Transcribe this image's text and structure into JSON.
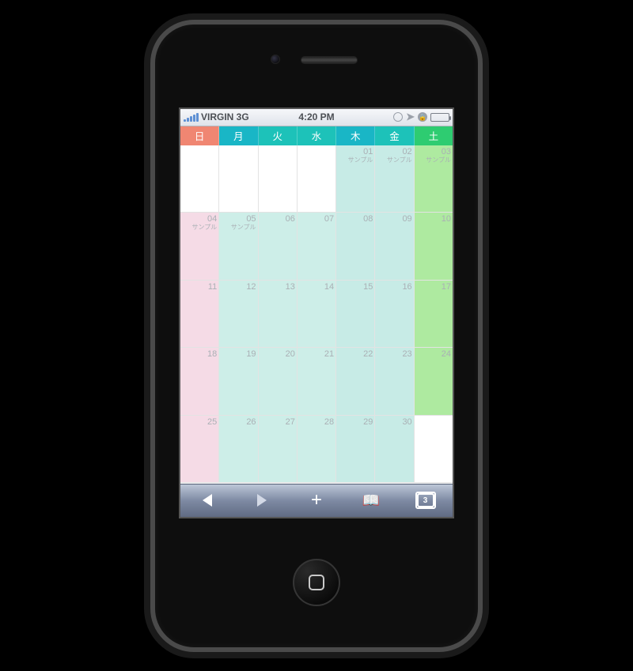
{
  "statusbar": {
    "carrier": "VIRGIN 3G",
    "time": "4:20 PM"
  },
  "safari": {
    "pages_count": "3"
  },
  "calendar": {
    "weekday_colors": {
      "sun": "#f08672",
      "mon": "#19b6c6",
      "tue": "#1dc2b9",
      "wed": "#1dc2b9",
      "thu": "#19b6c6",
      "fri": "#1dc2b9",
      "sat": "#2ecc71"
    },
    "cell_colors": {
      "blank": "#ffffff",
      "sun": "#f5dbe6",
      "weekday": "#cdeee8",
      "thu": "#c7ebe6",
      "fri": "#c7ebe6",
      "sat": "#aeeaa0"
    },
    "weekdays": [
      "日",
      "月",
      "火",
      "水",
      "木",
      "金",
      "土"
    ],
    "weeks": [
      [
        {
          "d": "",
          "e": "",
          "bg": "blank"
        },
        {
          "d": "",
          "e": "",
          "bg": "blank"
        },
        {
          "d": "",
          "e": "",
          "bg": "blank"
        },
        {
          "d": "",
          "e": "",
          "bg": "blank"
        },
        {
          "d": "01",
          "e": "サンプル",
          "bg": "thu"
        },
        {
          "d": "02",
          "e": "サンプル",
          "bg": "fri"
        },
        {
          "d": "03",
          "e": "サンプル",
          "bg": "sat"
        }
      ],
      [
        {
          "d": "04",
          "e": "サンプル",
          "bg": "sun"
        },
        {
          "d": "05",
          "e": "サンプル",
          "bg": "weekday"
        },
        {
          "d": "06",
          "e": "",
          "bg": "weekday"
        },
        {
          "d": "07",
          "e": "",
          "bg": "weekday"
        },
        {
          "d": "08",
          "e": "",
          "bg": "thu"
        },
        {
          "d": "09",
          "e": "",
          "bg": "fri"
        },
        {
          "d": "10",
          "e": "",
          "bg": "sat"
        }
      ],
      [
        {
          "d": "11",
          "e": "",
          "bg": "sun"
        },
        {
          "d": "12",
          "e": "",
          "bg": "weekday"
        },
        {
          "d": "13",
          "e": "",
          "bg": "weekday"
        },
        {
          "d": "14",
          "e": "",
          "bg": "weekday"
        },
        {
          "d": "15",
          "e": "",
          "bg": "thu"
        },
        {
          "d": "16",
          "e": "",
          "bg": "fri"
        },
        {
          "d": "17",
          "e": "",
          "bg": "sat"
        }
      ],
      [
        {
          "d": "18",
          "e": "",
          "bg": "sun"
        },
        {
          "d": "19",
          "e": "",
          "bg": "weekday"
        },
        {
          "d": "20",
          "e": "",
          "bg": "weekday"
        },
        {
          "d": "21",
          "e": "",
          "bg": "weekday"
        },
        {
          "d": "22",
          "e": "",
          "bg": "thu"
        },
        {
          "d": "23",
          "e": "",
          "bg": "fri"
        },
        {
          "d": "24",
          "e": "",
          "bg": "sat"
        }
      ],
      [
        {
          "d": "25",
          "e": "",
          "bg": "sun"
        },
        {
          "d": "26",
          "e": "",
          "bg": "weekday"
        },
        {
          "d": "27",
          "e": "",
          "bg": "weekday"
        },
        {
          "d": "28",
          "e": "",
          "bg": "weekday"
        },
        {
          "d": "29",
          "e": "",
          "bg": "thu"
        },
        {
          "d": "30",
          "e": "",
          "bg": "fri"
        },
        {
          "d": "",
          "e": "",
          "bg": "blank"
        }
      ]
    ]
  }
}
